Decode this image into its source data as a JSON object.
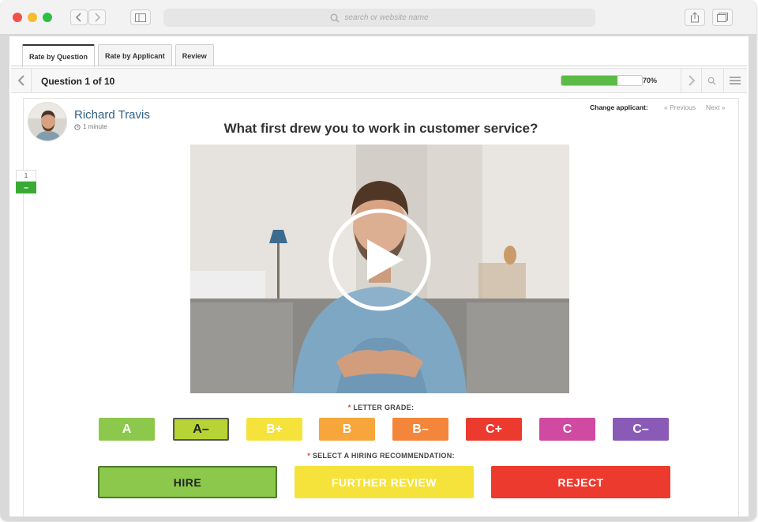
{
  "browser": {
    "address_placeholder": "search or website name"
  },
  "tabs": [
    {
      "label": "Rate by Question",
      "active": true
    },
    {
      "label": "Rate by Applicant",
      "active": false
    },
    {
      "label": "Review",
      "active": false
    }
  ],
  "question_bar": {
    "title": "Question 1 of 10",
    "progress_percent": 70,
    "progress_label": "70%",
    "progress_color": "#5cba47"
  },
  "question_indicator": {
    "number": "1",
    "badge": "–",
    "badge_color": "#3aaa35"
  },
  "applicant": {
    "name": "Richard Travis",
    "duration": "1 minute"
  },
  "change_applicant": {
    "label": "Change applicant:",
    "previous": "« Previous",
    "next": "Next »"
  },
  "question_text": "What first drew you to work in customer service?",
  "grading": {
    "label": "LETTER GRADE:",
    "required_mark": "*",
    "grades": [
      {
        "label": "A",
        "color": "#8cc84b",
        "selected": false
      },
      {
        "label": "A–",
        "color": "#b8d335",
        "selected": true
      },
      {
        "label": "B+",
        "color": "#f5e33c",
        "selected": false
      },
      {
        "label": "B",
        "color": "#f6a63a",
        "selected": false
      },
      {
        "label": "B–",
        "color": "#f3863a",
        "selected": false
      },
      {
        "label": "C+",
        "color": "#ec3a2e",
        "selected": false
      },
      {
        "label": "C",
        "color": "#cf4aa0",
        "selected": false
      },
      {
        "label": "C–",
        "color": "#8a5bb6",
        "selected": false
      }
    ]
  },
  "recommendation": {
    "label": "SELECT A HIRING RECOMMENDATION:",
    "required_mark": "*",
    "options": [
      {
        "label": "HIRE",
        "color": "#8cc84b",
        "selected": true
      },
      {
        "label": "FURTHER REVIEW",
        "color": "#f5e33c",
        "selected": false
      },
      {
        "label": "REJECT",
        "color": "#ec3a2e",
        "selected": false
      }
    ]
  }
}
